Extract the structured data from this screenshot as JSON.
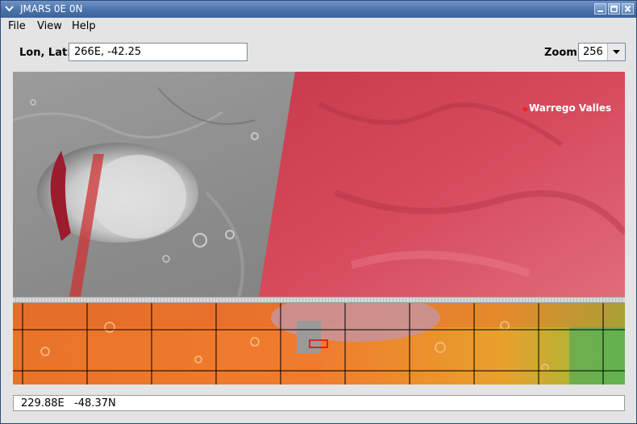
{
  "window": {
    "title": "JMARS 0E 0N"
  },
  "menu": [
    {
      "label": "File"
    },
    {
      "label": "View"
    },
    {
      "label": "Help"
    }
  ],
  "toolbar": {
    "lonlat_label": "Lon, Lat:",
    "lonlat_value": "266E, -42.25",
    "zoom_label": "Zoom:",
    "zoom_value": "256"
  },
  "map": {
    "landmark_label": "Warrego Valles",
    "landmark_color": "#ff1e1e",
    "overlay_color": "#c8283c"
  },
  "status": {
    "coords": "229.88E   -48.37N"
  },
  "colors": {
    "titlebar": "#4a72ab",
    "window_bg": "#e4e4e4"
  }
}
